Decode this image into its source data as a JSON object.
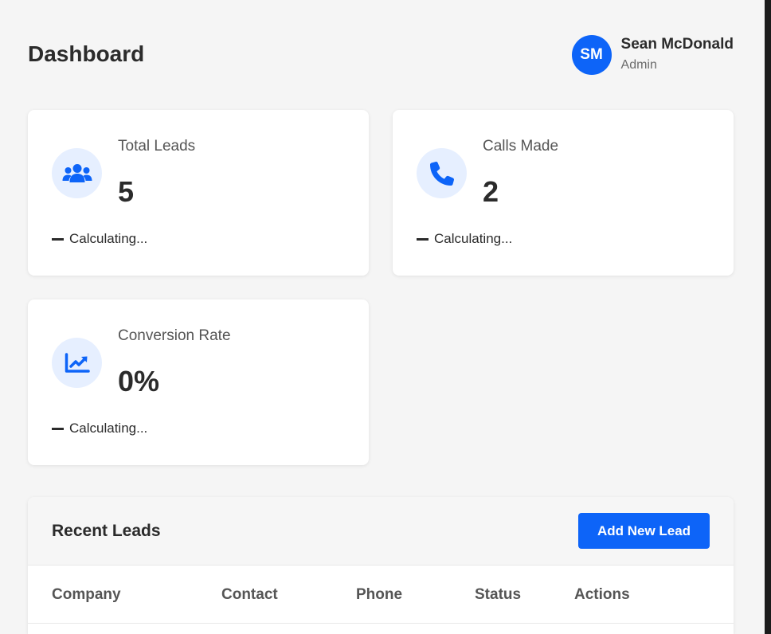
{
  "header": {
    "title": "Dashboard"
  },
  "user": {
    "initials": "SM",
    "name": "Sean McDonald",
    "role": "Admin"
  },
  "stats": [
    {
      "label": "Total Leads",
      "value": "5",
      "trend": "Calculating...",
      "icon": "users-icon"
    },
    {
      "label": "Calls Made",
      "value": "2",
      "trend": "Calculating...",
      "icon": "phone-icon"
    },
    {
      "label": "Conversion Rate",
      "value": "0%",
      "trend": "Calculating...",
      "icon": "chart-line-icon"
    }
  ],
  "recent_leads": {
    "title": "Recent Leads",
    "add_button": "Add New Lead",
    "columns": [
      "Company",
      "Contact",
      "Phone",
      "Status",
      "Actions"
    ]
  },
  "colors": {
    "accent": "#0d64f8",
    "icon_bg": "#e6efff",
    "page_bg": "#f5f5f5"
  }
}
